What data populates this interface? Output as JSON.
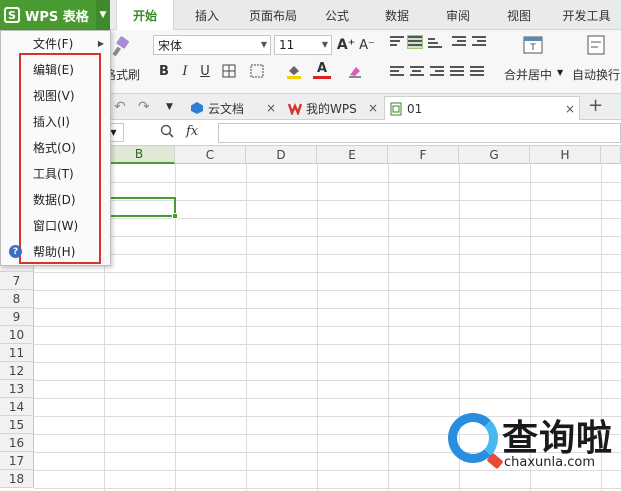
{
  "app": {
    "menu_label": "WPS 表格",
    "logo_glyph": "S",
    "accent": "#4a9a32"
  },
  "ribbon_tabs": [
    {
      "label": "开始",
      "active": true
    },
    {
      "label": "插入"
    },
    {
      "label": "页面布局"
    },
    {
      "label": "公式"
    },
    {
      "label": "数据"
    },
    {
      "label": "审阅"
    },
    {
      "label": "视图"
    },
    {
      "label": "开发工具"
    }
  ],
  "ribbon": {
    "format_painter_label": "格式刷",
    "font_name": "宋体",
    "font_size": "11",
    "grow_font": "A⁺",
    "shrink_font": "A⁻",
    "bold": "B",
    "italic": "I",
    "underline": "U",
    "merge_label": "合并居中",
    "wrap_label": "自动换行"
  },
  "doc_tabs": [
    {
      "label": "云文档",
      "icon": "cloud-doc-icon"
    },
    {
      "label": "我的WPS",
      "icon": "wps-logo-icon"
    },
    {
      "label": "01",
      "icon": "spreadsheet-icon",
      "active": true
    }
  ],
  "doc_tab_close": "×",
  "doc_tab_add": "+",
  "formula_bar": {
    "fx_label": "fx"
  },
  "columns": [
    "B",
    "C",
    "D",
    "E",
    "F",
    "G",
    "H"
  ],
  "selected_column": "B",
  "rows": [
    "7",
    "8",
    "9",
    "10",
    "11",
    "12",
    "13",
    "14",
    "15",
    "16",
    "17",
    "18"
  ],
  "menu": {
    "items": [
      {
        "label": "文件(F)",
        "submenu": true
      },
      {
        "label": "编辑(E)"
      },
      {
        "label": "视图(V)"
      },
      {
        "label": "插入(I)"
      },
      {
        "label": "格式(O)"
      },
      {
        "label": "工具(T)"
      },
      {
        "label": "数据(D)"
      },
      {
        "label": "窗口(W)"
      },
      {
        "label": "帮助(H)"
      }
    ],
    "highlight_color": "#d9322f"
  },
  "watermark": {
    "cn": "查询啦",
    "en": "chaxunla.com"
  }
}
